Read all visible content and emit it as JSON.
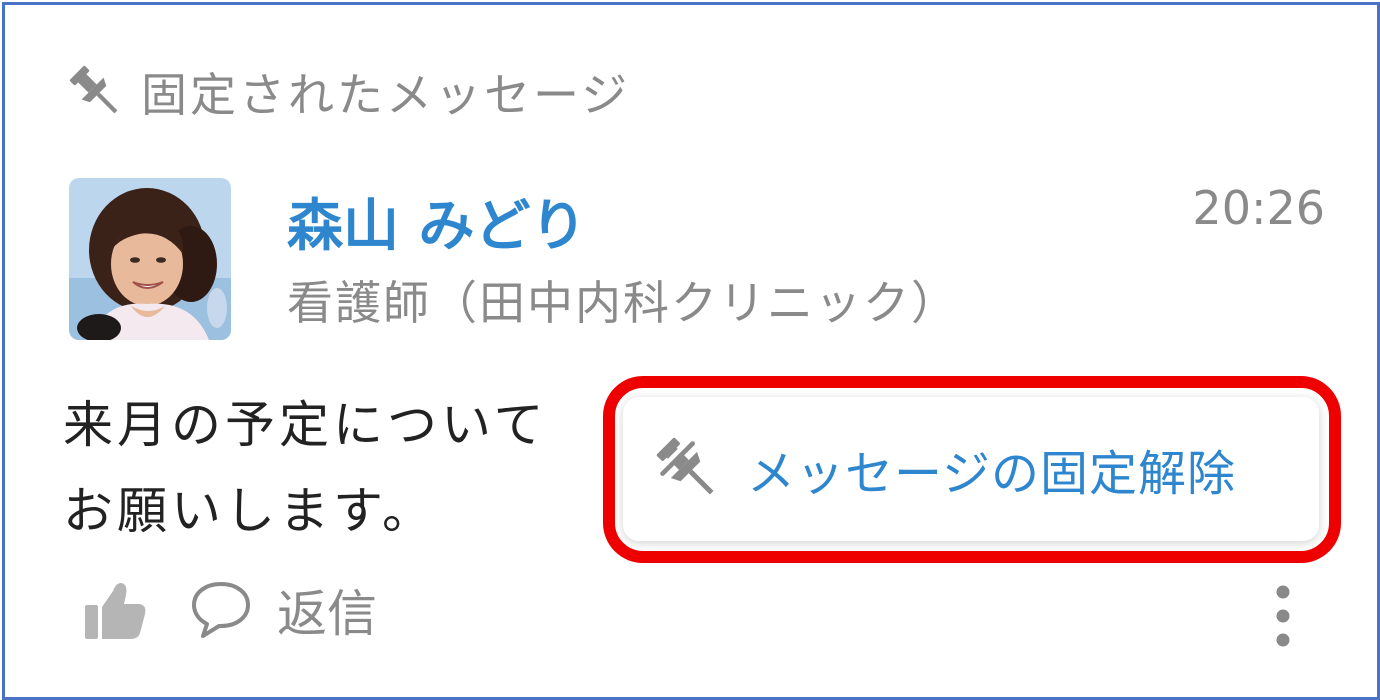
{
  "header": {
    "title": "固定されたメッセージ",
    "icon": "pin-icon"
  },
  "message": {
    "author": "森山 みどり",
    "role": "看護師（田中内科クリニック）",
    "time": "20:26",
    "text_line1": "来月の予定について",
    "text_line2": "お願いします。"
  },
  "actions": {
    "like_icon": "thumbs-up-icon",
    "reply_label": "返信",
    "reply_icon": "speech-bubble-icon",
    "more_icon": "more-vertical-icon"
  },
  "context_menu": {
    "unpin_label": "メッセージの固定解除",
    "unpin_icon": "unpin-icon"
  },
  "colors": {
    "frame_border": "#4a72c6",
    "author_name": "#2e86cf",
    "secondary_text": "#8a8a8a",
    "highlight": "#ee0000",
    "menu_text": "#2e86cf"
  }
}
